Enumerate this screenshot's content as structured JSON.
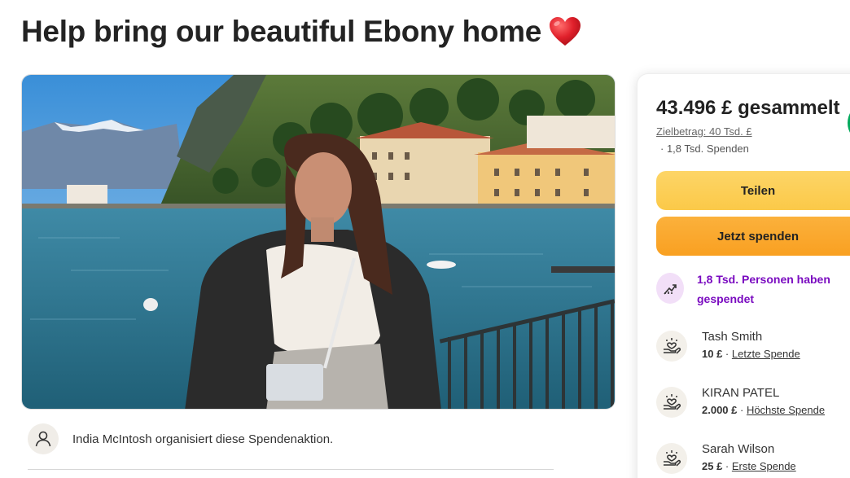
{
  "page": {
    "title": "Help bring our beautiful Ebony home"
  },
  "organizer": {
    "text": "India McIntosh organisiert diese Spendenaktion."
  },
  "summary": {
    "raised": "43.496 £ gesammelt",
    "goal": "Zielbetrag: 40 Tsd. £",
    "donations_count": "· 1,8 Tsd. Spenden"
  },
  "buttons": {
    "share": "Teilen",
    "donate": "Jetzt spenden"
  },
  "trend": {
    "text": "1,8 Tsd. Personen haben gespendet"
  },
  "donors": [
    {
      "name": "Tash Smith",
      "amount": "10 £",
      "sep": " · ",
      "tag": "Letzte Spende"
    },
    {
      "name": "KIRAN PATEL",
      "amount": "2.000 £",
      "sep": " · ",
      "tag": "Höchste Spende"
    },
    {
      "name": "Sarah Wilson",
      "amount": "25 £",
      "sep": " · ",
      "tag": "Erste Spende"
    }
  ],
  "colors": {
    "share_button": "#fbc948",
    "donate_button": "#f9a021",
    "trend_text": "#7a0bc0",
    "progress_ring": "#02a95c"
  }
}
